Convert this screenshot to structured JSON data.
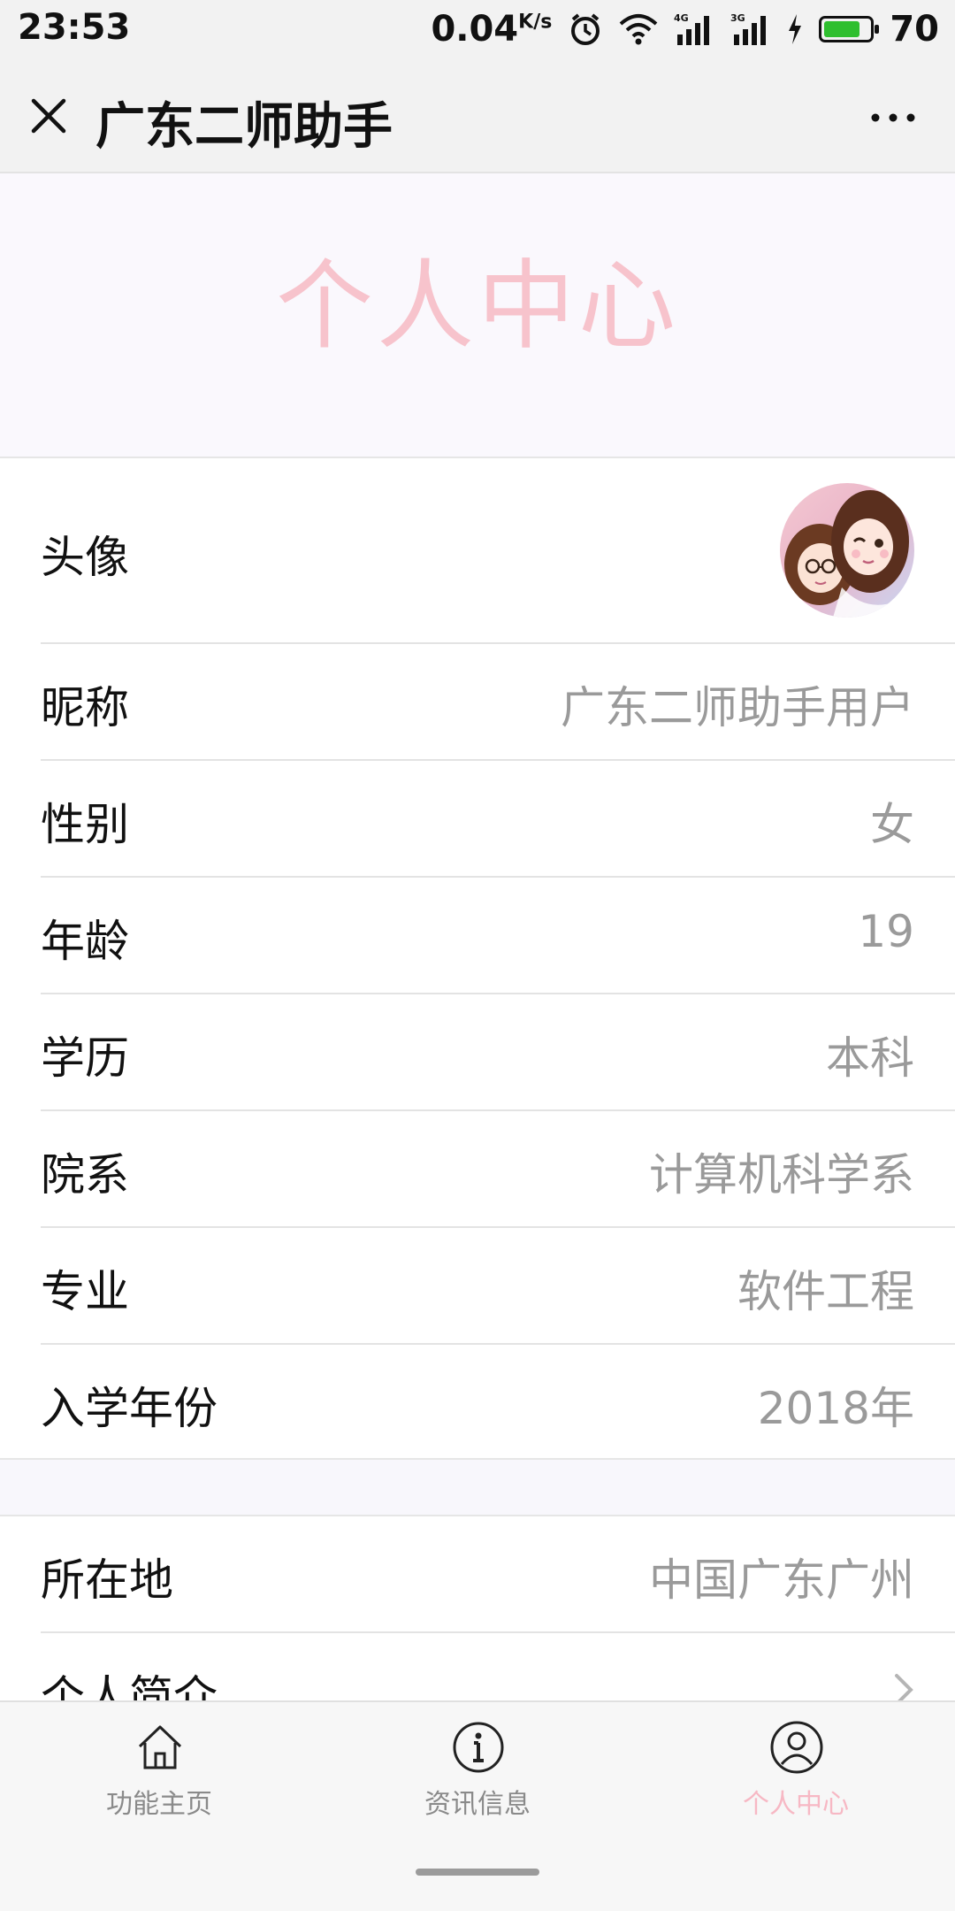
{
  "status_bar": {
    "time": "23:53",
    "speed": "0.04",
    "speed_unit": "K/s",
    "battery": "70",
    "icons": [
      "alarm-icon",
      "wifi-icon",
      "signal-4g-icon",
      "signal-3g-icon",
      "charging-icon",
      "battery-icon"
    ]
  },
  "nav": {
    "title": "广东二师助手",
    "close_icon": "close-icon",
    "more_icon": "more-icon"
  },
  "header": {
    "title": "个人中心"
  },
  "profile": {
    "avatar_label": "头像",
    "rows": [
      {
        "label": "昵称",
        "value": "广东二师助手用户"
      },
      {
        "label": "性别",
        "value": "女"
      },
      {
        "label": "年龄",
        "value": "19"
      },
      {
        "label": "学历",
        "value": "本科"
      },
      {
        "label": "院系",
        "value": "计算机科学系"
      },
      {
        "label": "专业",
        "value": "软件工程"
      },
      {
        "label": "入学年份",
        "value": "2018年"
      }
    ]
  },
  "extra": {
    "rows": [
      {
        "label": "所在地",
        "value": "中国广东广州"
      },
      {
        "label": "个人简介",
        "value": ""
      }
    ]
  },
  "tabbar": {
    "tabs": [
      {
        "label": "功能主页",
        "icon": "home-icon",
        "active": false
      },
      {
        "label": "资讯信息",
        "icon": "info-icon",
        "active": false
      },
      {
        "label": "个人中心",
        "icon": "user-icon",
        "active": true
      }
    ]
  },
  "colors": {
    "accent": "#f7c3cc",
    "value_text": "#9a9a9a",
    "background": "#f8f7fc"
  }
}
